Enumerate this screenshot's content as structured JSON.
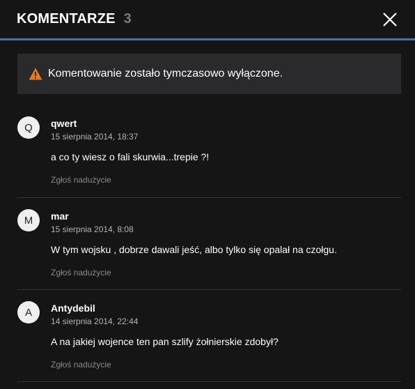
{
  "header": {
    "title": "KOMENTARZE",
    "count": "3"
  },
  "notice": {
    "text": "Komentowanie zostało tymczasowo wyłączone.",
    "icon": "warning-icon",
    "icon_color": "#e07b28"
  },
  "comments": [
    {
      "initial": "Q",
      "author": "qwert",
      "date": "15 sierpnia 2014, 18:37",
      "body": "a co ty wiesz o fali skurwia...trepie ?!",
      "report": "Zgłoś nadużycie"
    },
    {
      "initial": "M",
      "author": "mar",
      "date": "15 sierpnia 2014, 8:08",
      "body": "W tym wojsku , dobrze dawali jeść, albo tylko się opalał na czołgu.",
      "report": "Zgłoś nadużycie"
    },
    {
      "initial": "A",
      "author": "Antydebil",
      "date": "14 sierpnia 2014, 22:44",
      "body": "A na jakiej wojence ten pan szlify żołnierskie zdobył?",
      "report": "Zgłoś nadużycie"
    }
  ],
  "colors": {
    "background": "#151515",
    "accent_line": "#4a6ea8",
    "notice_bg": "#2a2a2c"
  }
}
